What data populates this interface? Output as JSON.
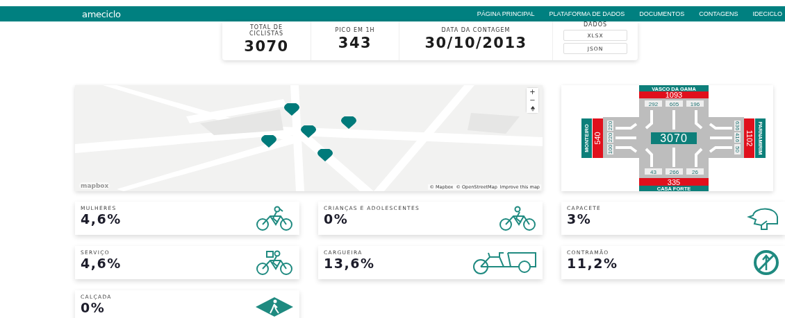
{
  "nav": {
    "logo": "ameciclo",
    "links": [
      "PÁGINA PRINCIPAL",
      "PLATAFORMA DE DADOS",
      "DOCUMENTOS",
      "CONTAGENS",
      "IDECICLO"
    ]
  },
  "summary": {
    "stats": [
      {
        "label": "TOTAL DE CICLISTAS",
        "value": "3070"
      },
      {
        "label": "PICO EM 1H",
        "value": "343"
      },
      {
        "label": "DATA DA CONTAGEM",
        "value": "30/10/2013"
      }
    ],
    "downloads": {
      "label": "DADOS",
      "buttons": [
        "XLSX",
        "JSON"
      ]
    }
  },
  "map": {
    "controls": [
      "+",
      "−"
    ],
    "logo": "mapbox",
    "attribution": [
      "© Mapbox",
      "© OpenStreetMap",
      "Improve this map"
    ]
  },
  "intersection": {
    "total": "3070",
    "north": {
      "name": "VASCO DA GAMA",
      "total": "1093",
      "movements": [
        "292",
        "605",
        "196"
      ]
    },
    "south": {
      "name": "CASA FORTE",
      "total": "335",
      "movements": [
        "43",
        "266",
        "26"
      ]
    },
    "west": {
      "name": "MONTEIRO",
      "total": "540",
      "movements": [
        "220",
        "220",
        "100"
      ]
    },
    "east": {
      "name": "PARNAMIRIM",
      "total": "1102",
      "movements": [
        "636",
        "416",
        "50"
      ]
    }
  },
  "indicators": [
    {
      "label": "MULHERES",
      "value": "4,6%",
      "kind": "woman"
    },
    {
      "label": "CRIANÇAS E ADOLESCENTES",
      "value": "0%",
      "kind": "child"
    },
    {
      "label": "CAPACETE",
      "value": "3%",
      "kind": "helmet"
    },
    {
      "label": "SERVIÇO",
      "value": "4,6%",
      "kind": "delivery"
    },
    {
      "label": "CARGUEIRA",
      "value": "13,6%",
      "kind": "cargo"
    },
    {
      "label": "CONTRAMÃO",
      "value": "11,2%",
      "kind": "wrongway"
    },
    {
      "label": "CALÇADA",
      "value": "0%",
      "kind": "sidewalk"
    }
  ]
}
